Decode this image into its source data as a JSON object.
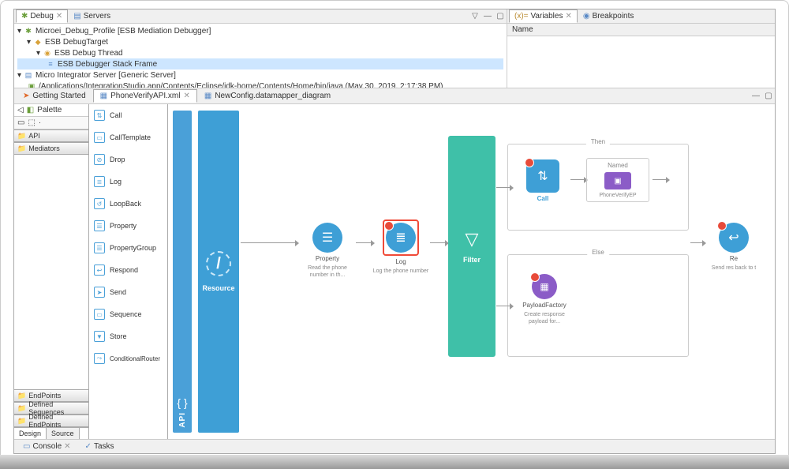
{
  "debug_panel": {
    "tab_debug": "Debug",
    "tab_servers": "Servers",
    "tree": {
      "profile": "Microei_Debug_Profile [ESB Mediation Debugger]",
      "target": "ESB DebugTarget",
      "thread": "ESB Debug Thread",
      "frame": "ESB Debugger Stack Frame",
      "server": "Micro Integrator Server [Generic Server]",
      "server_path": "/Applications/IntegrationStudio.app/Contents/Eclipse/jdk-home/Contents/Home/bin/java (May 30, 2019, 2:17:38 PM)"
    }
  },
  "vars_panel": {
    "tab_vars": "Variables",
    "tab_breakpoints": "Breakpoints",
    "col_name": "Name"
  },
  "editor_tabs": {
    "getting_started": "Getting Started",
    "phone_verify": "PhoneVerifyAPI.xml",
    "new_config": "NewConfig.datamapper_diagram"
  },
  "palette": {
    "header": "Palette",
    "cat_api": "API",
    "cat_mediators": "Mediators",
    "items": {
      "call": "Call",
      "calltemplate": "CallTemplate",
      "drop": "Drop",
      "log": "Log",
      "loopback": "LoopBack",
      "property": "Property",
      "propertygroup": "PropertyGroup",
      "respond": "Respond",
      "send": "Send",
      "sequence": "Sequence",
      "store": "Store",
      "conditionalrouter": "ConditionalRouter"
    },
    "cat_endpoints": "EndPoints",
    "cat_defseq": "Defined Sequences",
    "cat_defep": "Defined EndPoints"
  },
  "design_source": {
    "design": "Design",
    "source": "Source"
  },
  "canvas": {
    "api_label": "API",
    "resource_label": "Resource",
    "property": {
      "title": "Property",
      "sub": "Read the phone number in th..."
    },
    "log": {
      "title": "Log",
      "sub": "Log the phone number"
    },
    "filter_label": "Filter",
    "then_label": "Then",
    "else_label": "Else",
    "call": {
      "title": "Call"
    },
    "named": {
      "label": "Named",
      "name": "PhoneVerifyEP"
    },
    "payload": {
      "title": "PayloadFactory",
      "sub": "Create response payload for..."
    },
    "respond": {
      "title": "Re",
      "sub": "Send res back to t"
    }
  },
  "console": {
    "tab_console": "Console",
    "tab_tasks": "Tasks"
  }
}
